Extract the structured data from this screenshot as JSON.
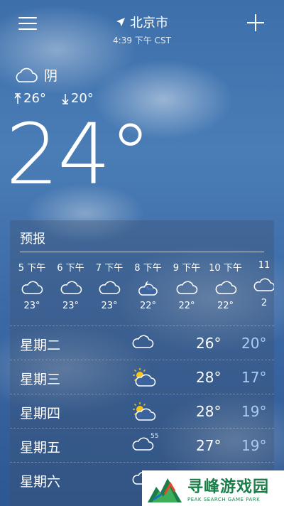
{
  "header": {
    "city": "北京市",
    "time": "4:39 下午 CST"
  },
  "current": {
    "condition": "阴",
    "condition_icon": "cloud-icon",
    "high": "26°",
    "low": "20°",
    "temperature": "24°"
  },
  "forecast": {
    "title": "预报",
    "hourly": [
      {
        "label": "5 下午",
        "icon": "cloud-icon",
        "temp": "23°"
      },
      {
        "label": "6 下午",
        "icon": "cloud-icon",
        "temp": "23°"
      },
      {
        "label": "7 下午",
        "icon": "cloud-icon",
        "temp": "23°"
      },
      {
        "label": "8 下午",
        "icon": "moon-cloud-icon",
        "temp": "22°"
      },
      {
        "label": "9 下午",
        "icon": "cloud-icon",
        "temp": "22°"
      },
      {
        "label": "10 下午",
        "icon": "cloud-icon",
        "temp": "22°"
      },
      {
        "label": "11",
        "icon": "cloud-icon",
        "temp": "2"
      }
    ],
    "daily": [
      {
        "day": "星期二",
        "icon": "cloud-icon",
        "high": "26°",
        "low": "20°",
        "precip": ""
      },
      {
        "day": "星期三",
        "icon": "sun-cloud-icon",
        "high": "28°",
        "low": "17°",
        "precip": ""
      },
      {
        "day": "星期四",
        "icon": "sun-cloud-icon",
        "high": "28°",
        "low": "19°",
        "precip": ""
      },
      {
        "day": "星期五",
        "icon": "cloud-icon",
        "high": "27°",
        "low": "19°",
        "precip": "55"
      },
      {
        "day": "星期六",
        "icon": "cloud-icon",
        "high": "",
        "low": "",
        "precip": ""
      }
    ]
  },
  "watermark": {
    "title": "寻峰游戏园",
    "subtitle": "PEAK SEARCH GAME PARK"
  },
  "colors": {
    "low_temp": "#a9cdf2",
    "watermark_green": "#1a7e48"
  }
}
